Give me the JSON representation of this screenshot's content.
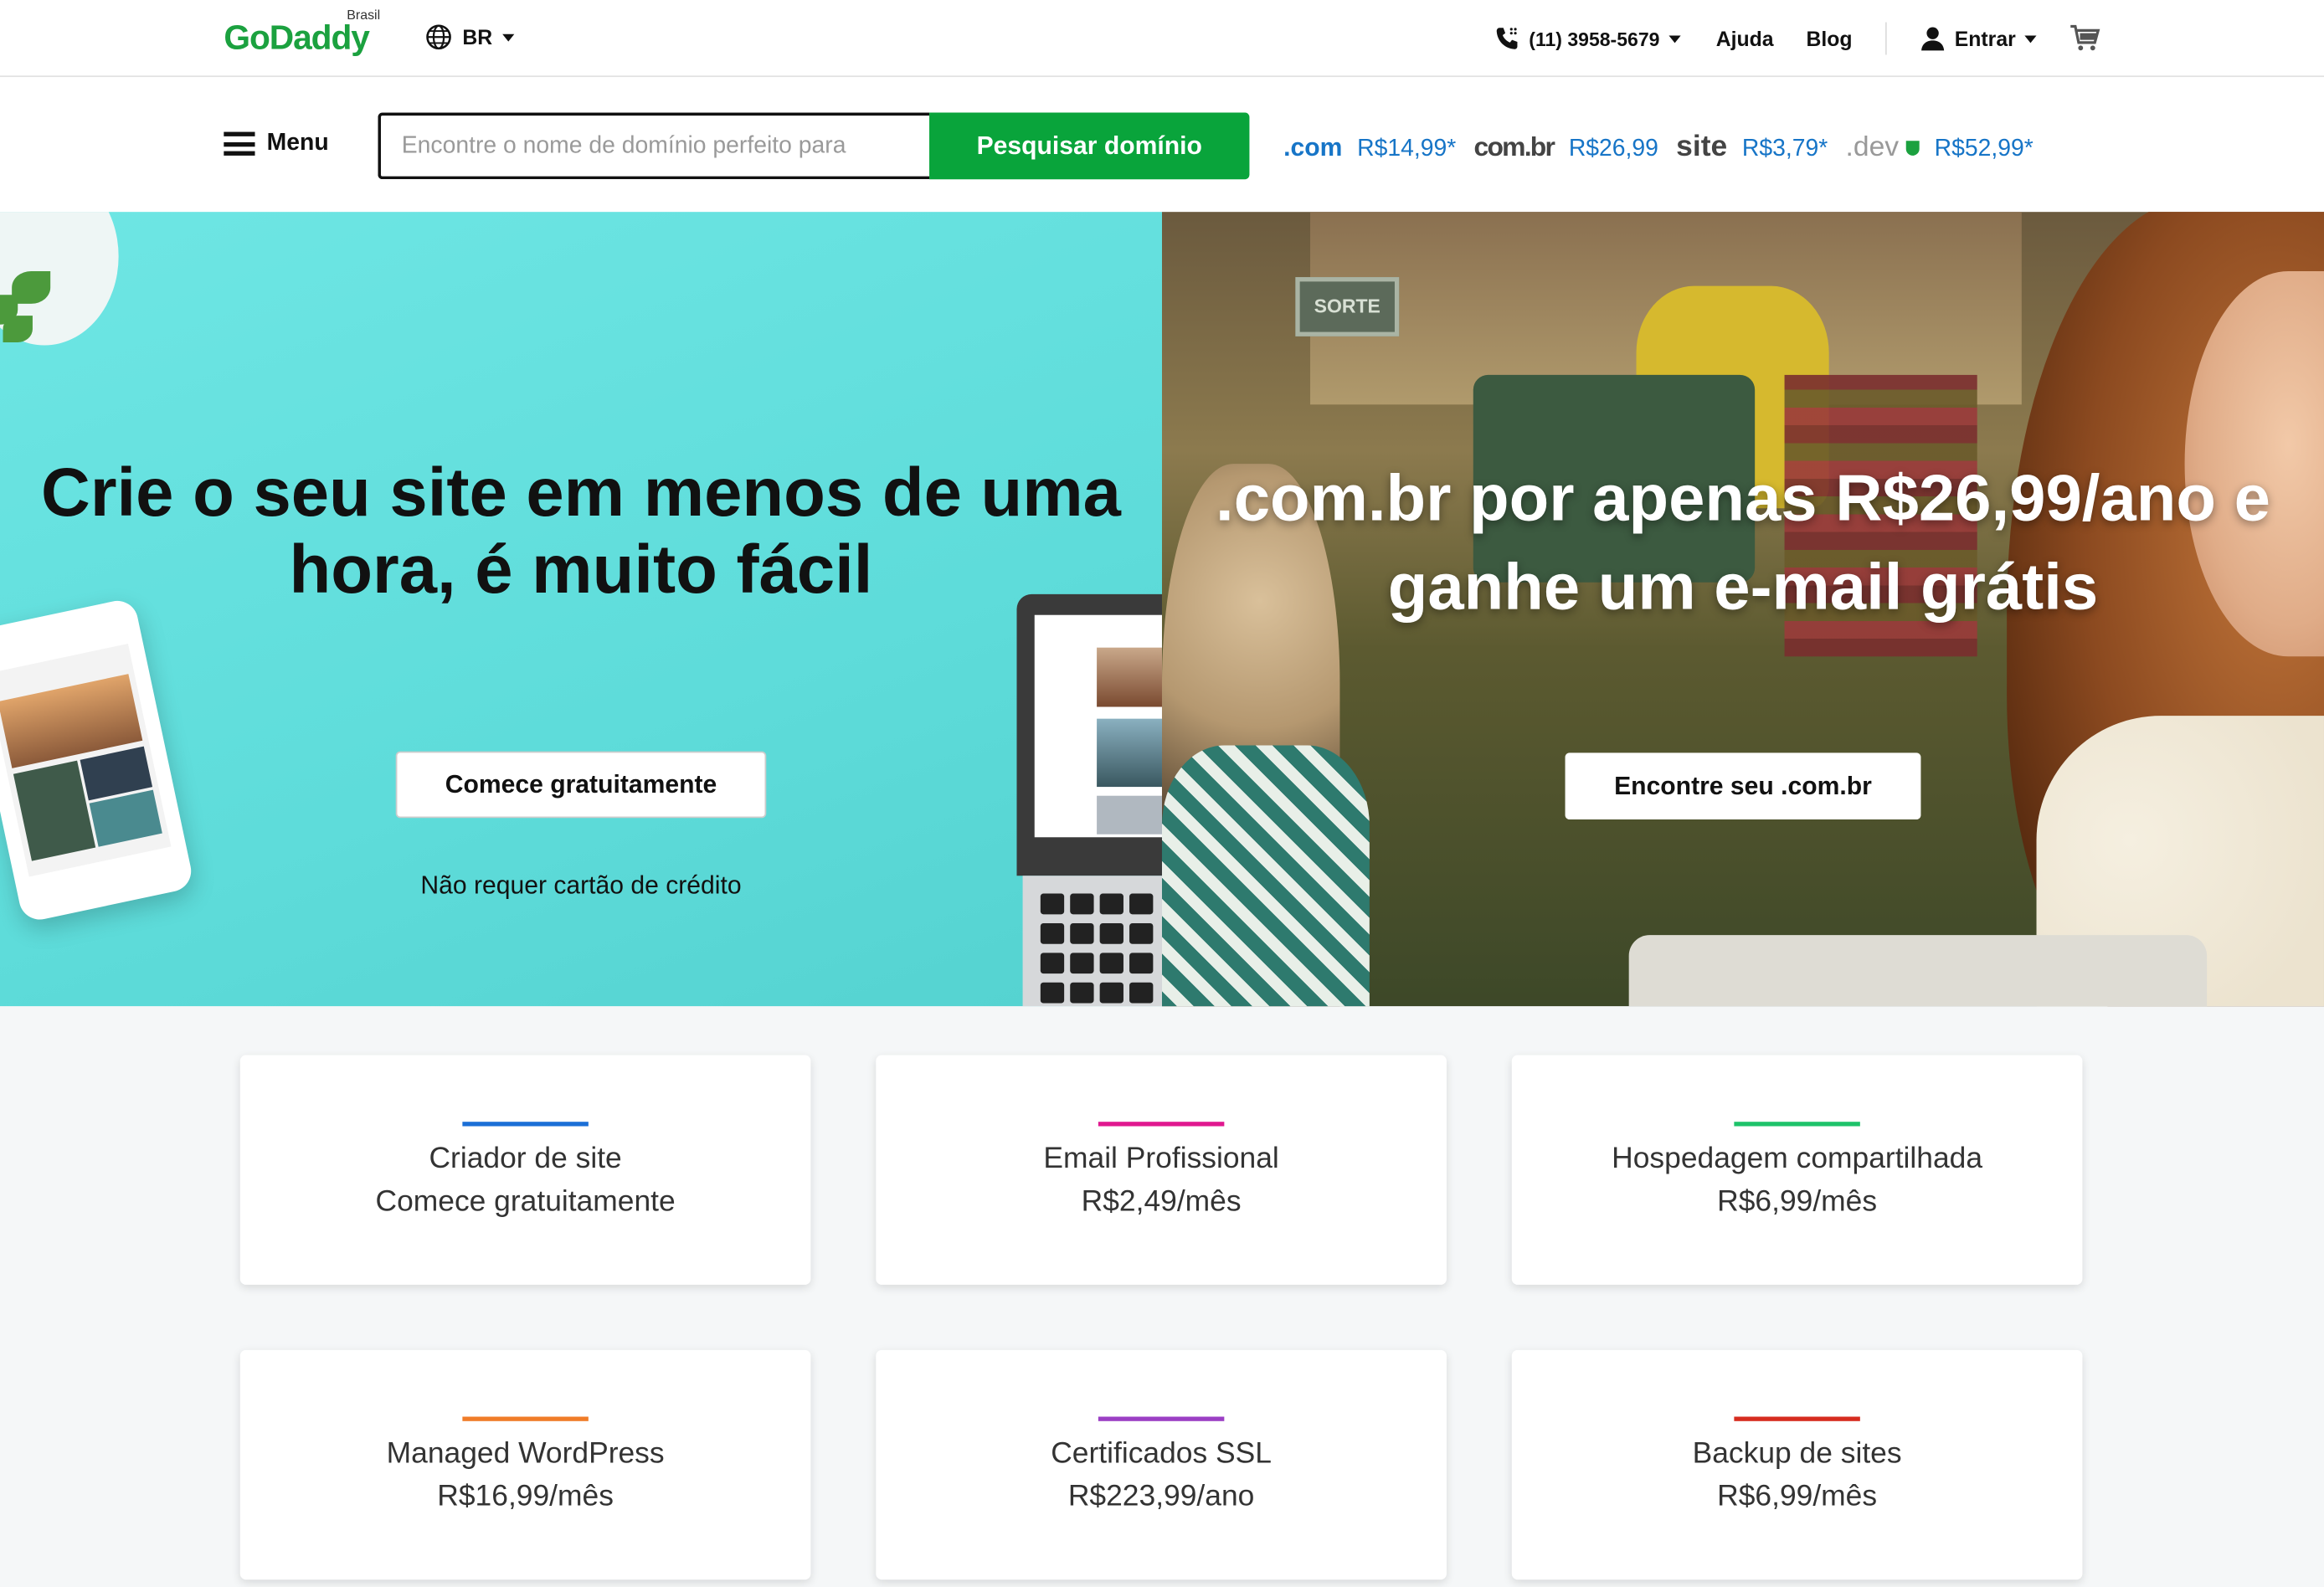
{
  "header": {
    "logo": "GoDaddy",
    "logo_region": "Brasil",
    "locale": "BR",
    "phone": "(11) 3958-5679",
    "nav": [
      "Ajuda",
      "Blog"
    ],
    "signin": "Entrar"
  },
  "search": {
    "menu_label": "Menu",
    "placeholder": "Encontre o nome de domínio perfeito para",
    "button": "Pesquisar domínio",
    "tlds": [
      {
        "name": ".com",
        "price": "R$14,99*"
      },
      {
        "name": "com.br",
        "price": "R$26,99"
      },
      {
        "name": "site",
        "price": "R$3,79*"
      },
      {
        "name": ".dev",
        "price": "R$52,99*"
      }
    ]
  },
  "hero_left": {
    "title": "Crie o seu site em menos de uma hora, é muito fácil",
    "button": "Comece gratuitamente",
    "note": "Não requer cartão de crédito"
  },
  "hero_right": {
    "title": ".com.br por apenas R$26,99/ano e ganhe um e-mail grátis",
    "button": "Encontre seu .com.br",
    "sign_text": "SORTE"
  },
  "products": [
    {
      "name": "Criador de site",
      "detail": "Comece gratuitamente",
      "color": "#1b6fd6"
    },
    {
      "name": "Email Profissional",
      "detail": "R$2,49/mês",
      "color": "#e0188f"
    },
    {
      "name": "Hospedagem compartilhada",
      "detail": "R$6,99/mês",
      "color": "#1ec36a"
    },
    {
      "name": "Managed WordPress",
      "detail": "R$16,99/mês",
      "color": "#f07c28"
    },
    {
      "name": "Certificados SSL",
      "detail": "R$223,99/ano",
      "color": "#9b3fc4"
    },
    {
      "name": "Backup de sites",
      "detail": "R$6,99/mês",
      "color": "#d62c1f"
    }
  ],
  "colors": {
    "brand_green": "#1ba13f",
    "search_button": "#09a43b",
    "price_link": "#1775c7",
    "hero_left_bg": "#6ee6e4"
  }
}
